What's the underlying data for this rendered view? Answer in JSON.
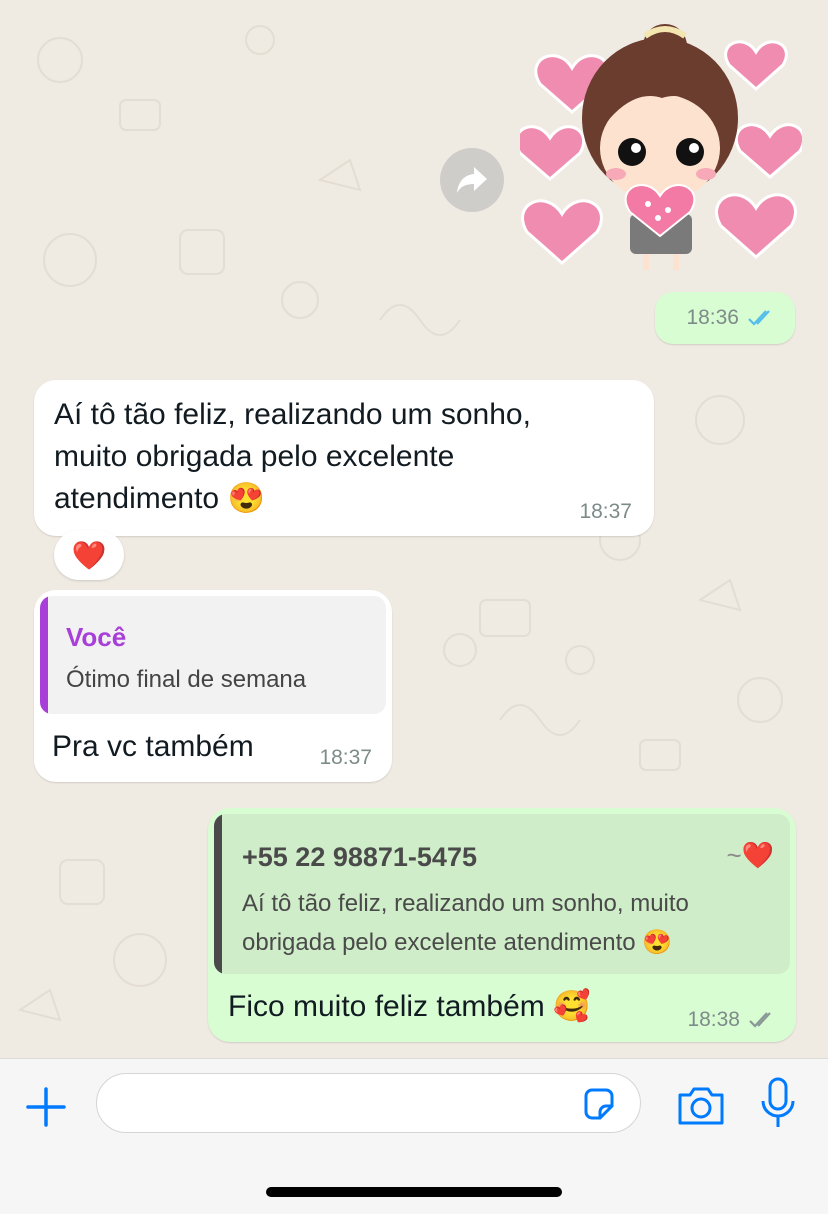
{
  "colors": {
    "wallpaper": "#efeae2",
    "incoming_bubble": "#ffffff",
    "outgoing_bubble": "#d9fdd3",
    "accent_blue": "#007aff",
    "read_ticks": "#53bdeb",
    "quote_you_name": "#a93fd9"
  },
  "messages": {
    "sticker": {
      "icon": "girl-holding-heart-sticker",
      "time": "18:36",
      "status": "read"
    },
    "incoming_1": {
      "line1": "Aí tô tão feliz, realizando um sonho,",
      "line2": "muito obrigada pelo excelente",
      "line3": "atendimento 😍",
      "time": "18:37",
      "reaction": "❤️"
    },
    "incoming_2": {
      "quote_author": "Você",
      "quote_text": "Ótimo final de semana",
      "text": "Pra vc também",
      "time": "18:37"
    },
    "outgoing_1": {
      "quote_author": "+55 22 98871-5475",
      "quote_author_suffix": "~❤️",
      "quote_line1": "Aí tô tão feliz, realizando um sonho, muito",
      "quote_line2": "obrigada pelo excelente atendimento 😍",
      "text": "Fico muito feliz também 🥰",
      "time": "18:38",
      "status": "delivered"
    }
  },
  "composer": {
    "placeholder": "",
    "icons": [
      "plus-icon",
      "sticker-icon",
      "camera-icon",
      "microphone-icon"
    ]
  }
}
